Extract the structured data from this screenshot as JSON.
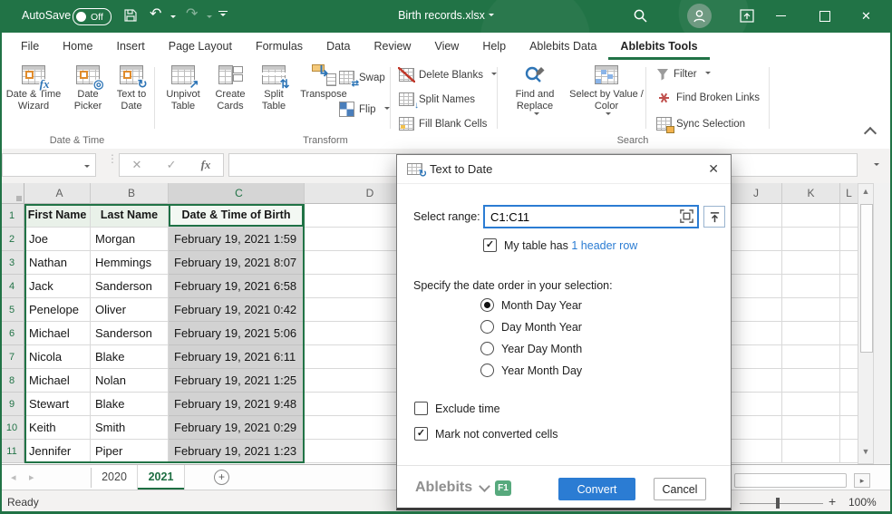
{
  "titlebar": {
    "autosave_label": "AutoSave",
    "autosave_state": "Off",
    "filename": "Birth records.xlsx"
  },
  "ribbon_tabs": {
    "items": [
      "File",
      "Home",
      "Insert",
      "Page Layout",
      "Formulas",
      "Data",
      "Review",
      "View",
      "Help",
      "Ablebits Data",
      "Ablebits Tools"
    ],
    "active": "Ablebits Tools",
    "share_label": "Share"
  },
  "ribbon": {
    "date_time": {
      "label": "Date & Time",
      "buttons": [
        "Date & Time Wizard",
        "Date Picker",
        "Text to Date"
      ]
    },
    "transform": {
      "label": "Transform",
      "big": [
        "Unpivot Table",
        "Create Cards",
        "Split Table",
        "Transpose"
      ],
      "small": [
        "Swap",
        "Flip"
      ],
      "list": [
        "Delete Blanks",
        "Split Names",
        "Fill Blank Cells"
      ]
    },
    "search": {
      "label": "Search",
      "big": [
        "Find and Replace",
        "Select by Value / Color"
      ],
      "list": [
        "Filter",
        "Find Broken Links",
        "Sync Selection"
      ]
    }
  },
  "formula_bar": {
    "name_box_value": "",
    "fx_label": "fx",
    "formula_value": ""
  },
  "sheet": {
    "columns_left": [
      "A",
      "B",
      "C",
      "D"
    ],
    "columns_right": [
      "J",
      "K",
      "L"
    ],
    "selected_range": "C1:C11",
    "header_row": {
      "num": "1",
      "first": "First Name",
      "last": "Last Name",
      "date": "Date & Time of Birth"
    },
    "rows": [
      {
        "num": "2",
        "first": "Joe",
        "last": "Morgan",
        "date": "February 19, 2021 1:59"
      },
      {
        "num": "3",
        "first": "Nathan",
        "last": "Hemmings",
        "date": "February 19, 2021 8:07"
      },
      {
        "num": "4",
        "first": "Jack",
        "last": "Sanderson",
        "date": "February 19, 2021 6:58"
      },
      {
        "num": "5",
        "first": "Penelope",
        "last": "Oliver",
        "date": "February 19, 2021 0:42"
      },
      {
        "num": "6",
        "first": "Michael",
        "last": "Sanderson",
        "date": "February 19, 2021 5:06"
      },
      {
        "num": "7",
        "first": "Nicola",
        "last": "Blake",
        "date": "February 19, 2021 6:11"
      },
      {
        "num": "8",
        "first": "Michael",
        "last": "Nolan",
        "date": "February 19, 2021 1:25"
      },
      {
        "num": "9",
        "first": "Stewart",
        "last": "Blake",
        "date": "February 19, 2021 9:48"
      },
      {
        "num": "10",
        "first": "Keith",
        "last": "Smith",
        "date": "February 19, 2021 0:29"
      },
      {
        "num": "11",
        "first": "Jennifer",
        "last": "Piper",
        "date": "February 19, 2021 1:23"
      }
    ]
  },
  "tabs_bar": {
    "sheets": [
      "2020",
      "2021"
    ],
    "active": "2021"
  },
  "status": {
    "mode": "Ready",
    "zoom": "100%"
  },
  "dialog": {
    "title": "Text to Date",
    "select_range_label": "Select range:",
    "range_value": "C1:C11",
    "header_checkbox": {
      "checked": true,
      "prefix": "My table has",
      "link": "1 header row"
    },
    "order_label": "Specify the date order in your selection:",
    "orders": [
      "Month Day Year",
      "Day Month Year",
      "Year Day Month",
      "Year Month Day"
    ],
    "selected_order": "Month Day Year",
    "exclude_time": {
      "label": "Exclude time",
      "checked": false
    },
    "mark_not_converted": {
      "label": "Mark not converted cells",
      "checked": true
    },
    "brand": "Ablebits",
    "help_badge": "F1",
    "convert_label": "Convert",
    "cancel_label": "Cancel"
  },
  "colors": {
    "excel_green": "#217346",
    "accent_blue": "#2b7cd3",
    "selection_gray": "#d2d2d2",
    "f1_badge": "#57a97d"
  }
}
